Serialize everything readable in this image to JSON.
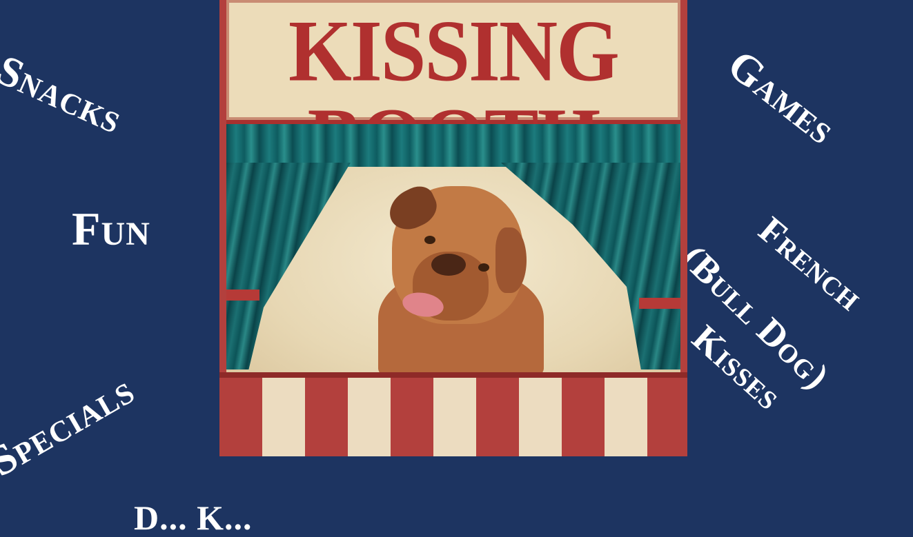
{
  "words": {
    "snacks": "Snacks",
    "fun": "Fun",
    "specials": "Specials",
    "games": "Games",
    "french": "French",
    "bull_dog": "(Bull Dog)",
    "kisses": "Kisses",
    "bottom_partial": "D... K..."
  },
  "booth": {
    "sign_text": "KISSING BOOTH"
  },
  "colors": {
    "background": "#1d3461",
    "sign": "#ecdcb9",
    "sign_text": "#b0302f",
    "curtain": "#1c7b7d",
    "stripe_red": "#b3403d",
    "stripe_cream": "#ecdcc0"
  }
}
